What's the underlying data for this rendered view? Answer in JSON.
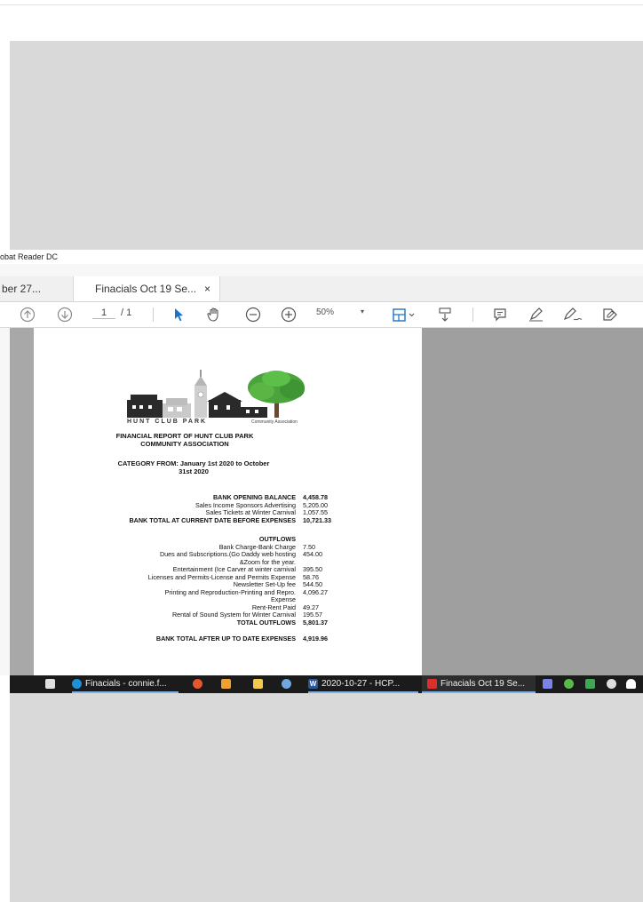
{
  "window": {
    "title": "obat Reader DC"
  },
  "tabs": [
    {
      "label": "ber 27..."
    },
    {
      "label": "Finacials Oct 19 Se...",
      "close": "×"
    }
  ],
  "toolbar": {
    "page_current": "1",
    "page_total": "/ 1",
    "zoom": "50%"
  },
  "document": {
    "logo_text": "HUNT CLUB PARK",
    "logo_sub": "Community Association",
    "title_line1": "FINANCIAL REPORT OF HUNT CLUB PARK",
    "title_line2": "COMMUNITY ASSOCIATION",
    "category_line1": "CATEGORY FROM: January 1st 2020 to October",
    "category_line2": "31st 2020",
    "rows": [
      {
        "label": "BANK OPENING BALANCE",
        "value": "4,458.78",
        "bold": true
      },
      {
        "label": "Sales Income Sponsors Advertising",
        "value": "5,205.00"
      },
      {
        "label": "Sales Tickets at Winter Carnival",
        "value": "1,057.55"
      },
      {
        "label": "BANK TOTAL AT CURRENT DATE BEFORE EXPENSES",
        "value": "10,721.33",
        "bold": true
      },
      {
        "label": "OUTFLOWS",
        "value": "",
        "bold": true
      },
      {
        "label": "Bank Charge-Bank Charge",
        "value": "7.50"
      },
      {
        "label": "Dues and Subscriptions.(Go Daddy web hosting",
        "value": "454.00"
      },
      {
        "label": "&Zoom for the year.",
        "value": ""
      },
      {
        "label": "Entertainment (Ice Carver at winter carnival",
        "value": "395.50"
      },
      {
        "label": "Licenses and Permits-License and Permits Expense",
        "value": "58.76"
      },
      {
        "label": "Newsletter Set-Up fee",
        "value": "544.50"
      },
      {
        "label": "Printing and Reproduction-Printing and Repro.",
        "value": "4,096.27"
      },
      {
        "label": "Expense",
        "value": ""
      },
      {
        "label": "Rent-Rent Paid",
        "value": "49.27"
      },
      {
        "label": "Rental of Sound System for Winter Carnival",
        "value": "195.57"
      },
      {
        "label": "TOTAL OUTFLOWS",
        "value": "5,801.37",
        "bold": true
      },
      {
        "label": "BANK TOTAL AFTER UP TO DATE EXPENSES",
        "value": "4,919.96",
        "bold": true
      }
    ]
  },
  "taskbar": {
    "items": [
      {
        "label": "Finacials - connie.f...",
        "color": "#1f8fd8"
      },
      {
        "label": "2020-10-27 - HCP...",
        "color": "#2b579a",
        "badge": "W"
      },
      {
        "label": "Finacials Oct 19 Se...",
        "color": "#d9302c"
      }
    ]
  },
  "colors": {
    "accent": "#1a73c8",
    "tree": "#4aa33b",
    "taskbar": "#1b1b1b"
  }
}
